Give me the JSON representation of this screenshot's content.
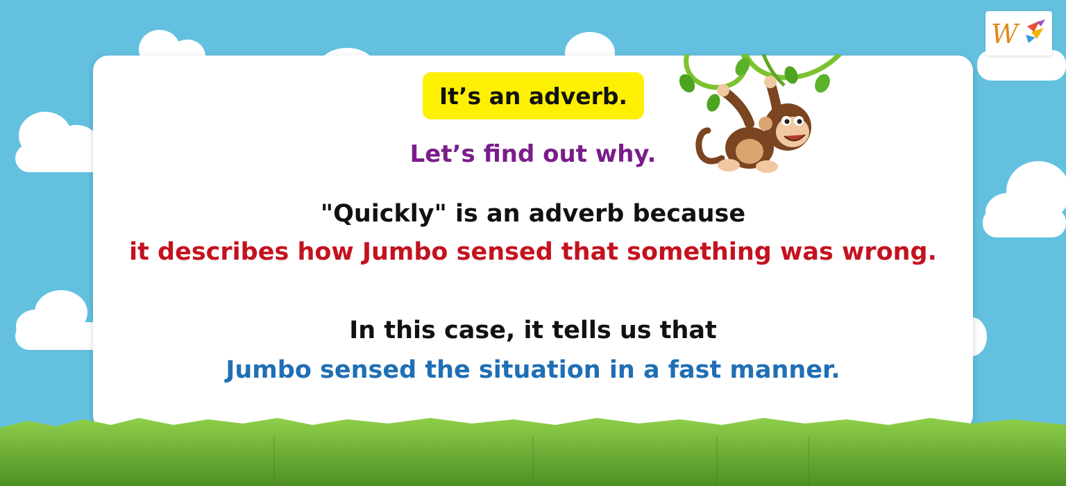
{
  "badge": {
    "text": "It’s an adverb."
  },
  "subtitle": "Let’s find out why.",
  "explanation": {
    "line1": "\"Quickly\" is an adverb because",
    "line2": "it describes how Jumbo sensed that something was wrong."
  },
  "detail": {
    "line1": "In this case, it tells us that",
    "line2": "Jumbo sensed the situation in a fast manner."
  },
  "logo": {
    "letter": "W",
    "icon": "brand-logo-icon"
  },
  "illustration": {
    "icon": "monkey-on-vine-icon"
  },
  "colors": {
    "sky": "#63c1df",
    "card": "#ffffff",
    "badge": "#fdf004",
    "purple": "#7a1d8a",
    "red": "#c4121f",
    "blue": "#1f6fb4",
    "grass": "#6fb23b"
  }
}
